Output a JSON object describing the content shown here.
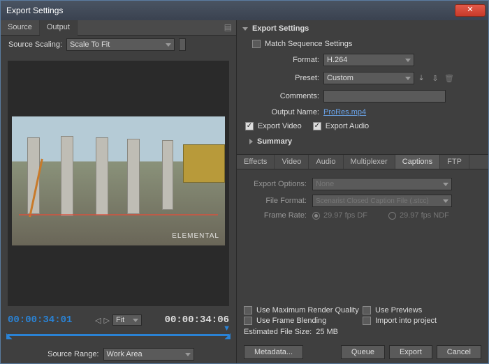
{
  "window": {
    "title": "Export Settings"
  },
  "left": {
    "tabs": {
      "source": "Source",
      "output": "Output"
    },
    "source_scaling_label": "Source Scaling:",
    "source_scaling_value": "Scale To Fit",
    "tc_in": "00:00:34:01",
    "tc_out": "00:00:34:06",
    "fit_label": "Fit",
    "source_range_label": "Source Range:",
    "source_range_value": "Work Area",
    "watermark": "ELEMENTAL"
  },
  "right": {
    "header": "Export Settings",
    "match_seq": "Match Sequence Settings",
    "format_label": "Format:",
    "format_value": "H.264",
    "preset_label": "Preset:",
    "preset_value": "Custom",
    "comments_label": "Comments:",
    "comments_value": "",
    "output_name_label": "Output Name:",
    "output_name_value": "ProRes.mp4",
    "export_video": "Export Video",
    "export_audio": "Export Audio",
    "summary": "Summary",
    "subtabs": [
      "Effects",
      "Video",
      "Audio",
      "Multiplexer",
      "Captions",
      "FTP"
    ],
    "captions": {
      "export_options_label": "Export Options:",
      "export_options_value": "None",
      "file_format_label": "File Format:",
      "file_format_value": "Scenarist Closed Caption File (.stcc)",
      "frame_rate_label": "Frame Rate:",
      "fr_df": "29.97 fps DF",
      "fr_ndf": "29.97 fps NDF"
    },
    "bottom": {
      "max_quality": "Use Maximum Render Quality",
      "use_previews": "Use Previews",
      "frame_blending": "Use Frame Blending",
      "import": "Import into project",
      "est_label": "Estimated File Size:",
      "est_value": "25 MB"
    },
    "buttons": {
      "metadata": "Metadata...",
      "queue": "Queue",
      "export": "Export",
      "cancel": "Cancel"
    }
  }
}
